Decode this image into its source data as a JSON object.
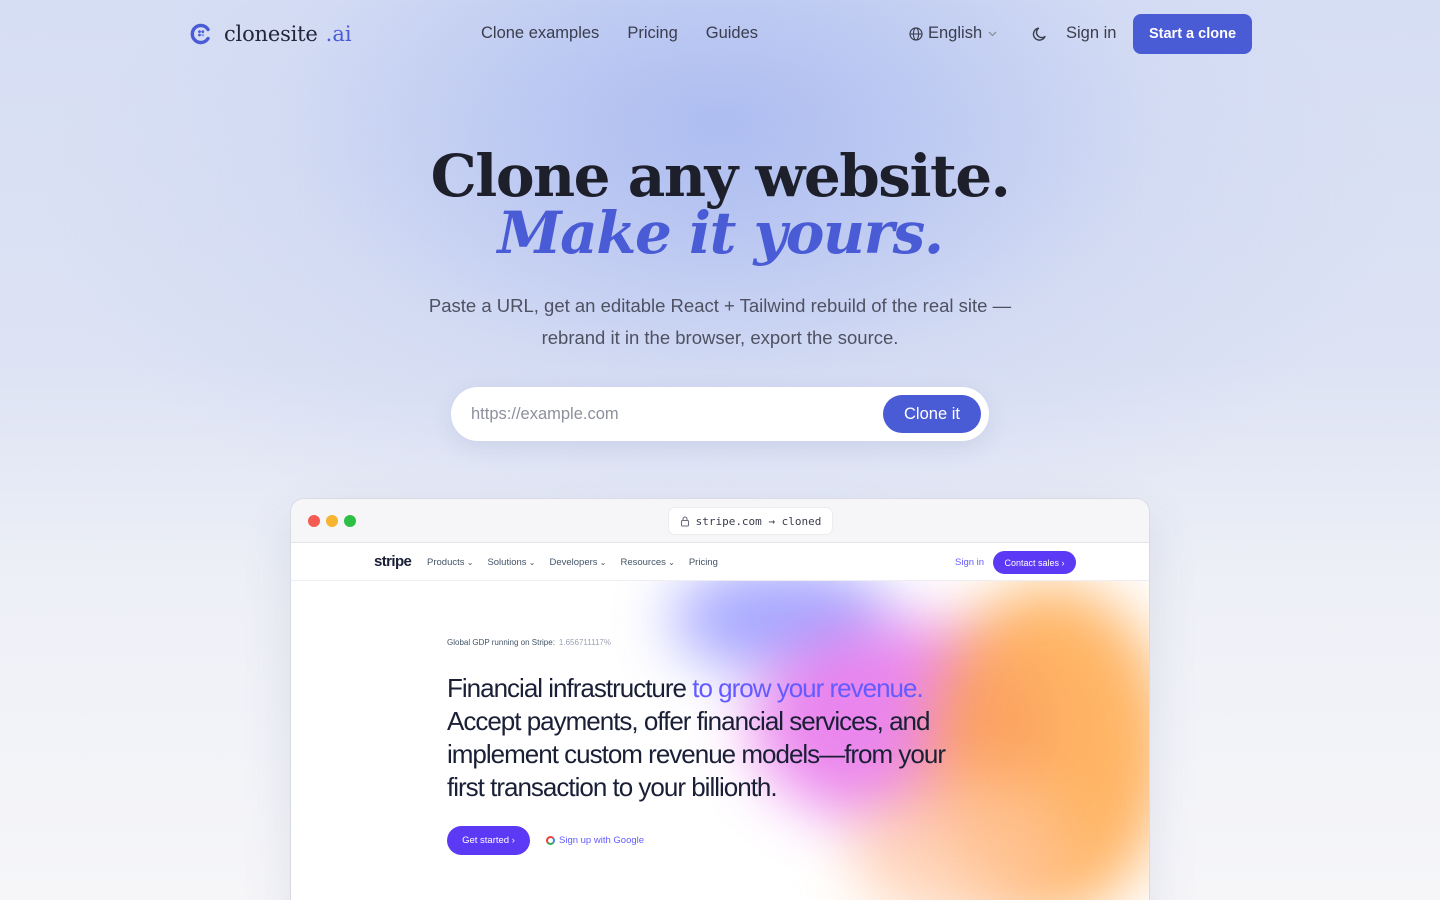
{
  "brand": {
    "name": "clonesite",
    "suffix": ".ai",
    "accent": "#4a5bd6"
  },
  "nav": {
    "links": [
      "Clone examples",
      "Pricing",
      "Guides"
    ],
    "language": "English",
    "signin": "Sign in",
    "cta": "Start a clone"
  },
  "hero": {
    "title": "Clone any website.",
    "subtitle": "Make it yours.",
    "description": "Paste a URL, get an editable React + Tailwind rebuild of the real site — rebrand it in the browser, export the source.",
    "input_placeholder": "https://example.com",
    "button": "Clone it"
  },
  "preview": {
    "address": "stripe.com → cloned",
    "site": {
      "logo": "stripe",
      "links": [
        "Products",
        "Solutions",
        "Developers",
        "Resources",
        "Pricing"
      ],
      "signin": "Sign in",
      "contact": "Contact sales ›",
      "gdp_label": "Global GDP running on Stripe:",
      "gdp_value": "1.656711117%",
      "headline_main": "Financial infrastructure",
      "headline_highlight": "to grow your revenue.",
      "headline_rest": "Accept payments, offer financial services, and implement custom revenue models—from your first transaction to your billionth.",
      "get_started": "Get started ›",
      "google": "Sign up with Google"
    }
  },
  "icons": [
    "logo-c-icon",
    "globe-icon",
    "chevron-down-icon",
    "moon-icon",
    "lock-icon",
    "google-icon"
  ]
}
